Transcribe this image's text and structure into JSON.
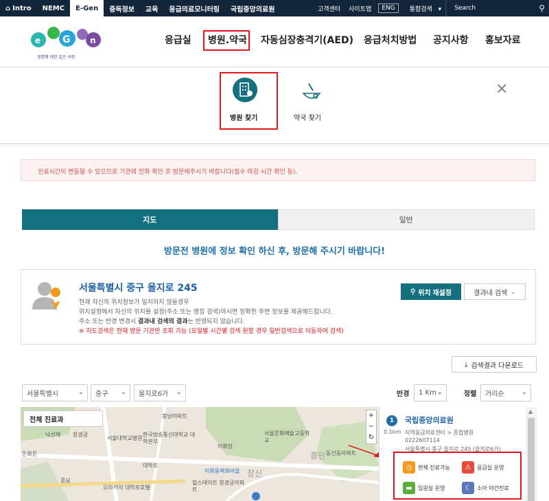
{
  "topbar": {
    "items": [
      "Intro",
      "NEMC",
      "E-Gen",
      "중독정보",
      "교육",
      "응급의료모니터링",
      "국립중앙의료원"
    ],
    "right_links": [
      "고객센터",
      "사이트맵",
      "ENG"
    ],
    "search_scope": "통합검색",
    "search_placeholder": "Search"
  },
  "logo": {
    "tagline": "생명에 대한 깊은 사랑"
  },
  "gnb": [
    "응급실",
    "병원.약국",
    "자동심장충격기(AED)",
    "응급처치방법",
    "공지사항",
    "홍보자료"
  ],
  "submenu": {
    "hospital": "병원 찾기",
    "pharmacy": "약국 찾기"
  },
  "notice": "진료시간이 변동될 수 있으므로 기관에 전화 확인 후 방문해주시기 바랍니다(접수 마감 시간 확인 등).",
  "tabs": {
    "map": "지도",
    "general": "일반"
  },
  "headline": "방문전 병원에 정보 확인 하신 후, 방문해 주시기 바랍니다!",
  "location": {
    "address": "서울특별시 중구 을지로 245",
    "line1": "현재 자신의 위치정보가 일치하지 않을경우",
    "line2": "위치설정에서 자신의 위치를 설정(주소 또는 명칭 검색)하시면 정확한 주변 정보를 제공해드립니다.",
    "line3_a": "주소 또는 반경 변경시 ",
    "line3_b": "결과내 검색의 결과",
    "line3_c": "는 반영되지 않습니다.",
    "warning": "※ 지도검색은 현재 방문 기관만 조회 가능 (요일별 시간별 검색 원할 경우 일반검색으로 이동하여 검색)",
    "reset_button": "위치 재설정",
    "results_button": "결과내 검색"
  },
  "download_button": "검색결과 다운로드",
  "filters": {
    "sido": "서울특별시",
    "gu": "중구",
    "dong": "을지로6가",
    "radius_label": "반경",
    "radius": "1 Km",
    "sort_label": "정렬",
    "sort": "거리순"
  },
  "map": {
    "dept_chip": "전체 진료과",
    "zoom_in": "+",
    "zoom_out": "−",
    "labels": [
      "낙선재",
      "창경궁",
      "서울대학교병원",
      "한국방송통신대학교 대학본부",
      "이화장",
      "서울문화예술고등학교",
      "대학로",
      "돈화문",
      "종묘",
      "오라카이 대학로호텔",
      "힐스테이트 창경궁아파트",
      "이화동벽화마을",
      "흥인",
      "봉남아파트",
      "장신",
      "동선동아파트"
    ]
  },
  "result": {
    "index": "1",
    "distance": "0.1km",
    "name": "국립중앙의료원",
    "type": "지역응급의료센터 > 종합병원",
    "phone": "0222607114",
    "address": "서울특별시 중구 을지로 245 (을지로6가)",
    "services": [
      "현재 진료가능",
      "응급실 운영",
      "입원실 운영",
      "소아 야간진료"
    ]
  },
  "colors": {
    "navy": "#14263b",
    "teal": "#14707f",
    "blue": "#1c6fa8",
    "red": "#e0161c"
  }
}
